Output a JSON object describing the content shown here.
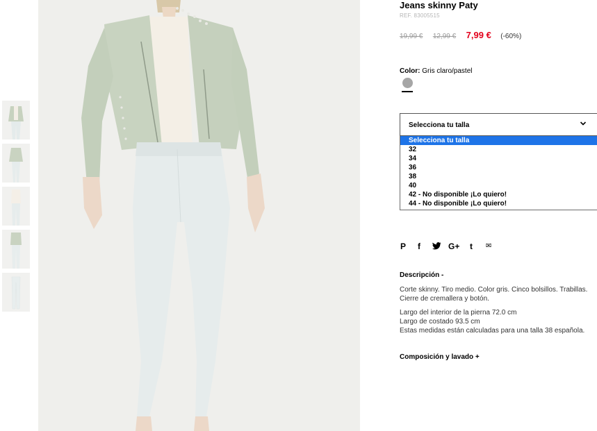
{
  "product": {
    "title": "Jeans skinny Paty",
    "ref": "REF. 83005515",
    "price_original": "19,99 €",
    "price_previous": "12,99 €",
    "price_current": "7,99 €",
    "discount": "(-60%)"
  },
  "color": {
    "label": "Color:",
    "value": "Gris claro/pastel",
    "swatch": "#a6a6a6"
  },
  "size_select": {
    "placeholder": "Selecciona tu talla",
    "options": [
      "Selecciona tu talla",
      "32",
      "34",
      "36",
      "38",
      "40",
      "42 - No disponible ¡Lo quiero!",
      "44 - No disponible ¡Lo quiero!"
    ]
  },
  "share_icons": [
    "pinterest-icon",
    "facebook-icon",
    "twitter-icon",
    "google-plus-icon",
    "tumblr-icon",
    "mail-icon"
  ],
  "share_glyphs": {
    "pinterest": "P",
    "facebook": "f",
    "twitter": "t",
    "google_plus": "G+",
    "tumblr": "t",
    "mail": "✉"
  },
  "description": {
    "title": "Descripción -",
    "line1": "Corte skinny. Tiro medio. Color gris. Cinco bolsillos. Trabillas.",
    "line2": "Cierre de cremallera y botón.",
    "line3": "Largo del interior de la pierna 72.0 cm",
    "line4": "Largo de costado 93.5 cm",
    "line5": "Estas medidas están calculadas para una talla 38 española."
  },
  "composition": {
    "title": "Composición y lavado +"
  },
  "colors": {
    "accent_red": "#e3001b",
    "select_highlight": "#1e74e8"
  }
}
